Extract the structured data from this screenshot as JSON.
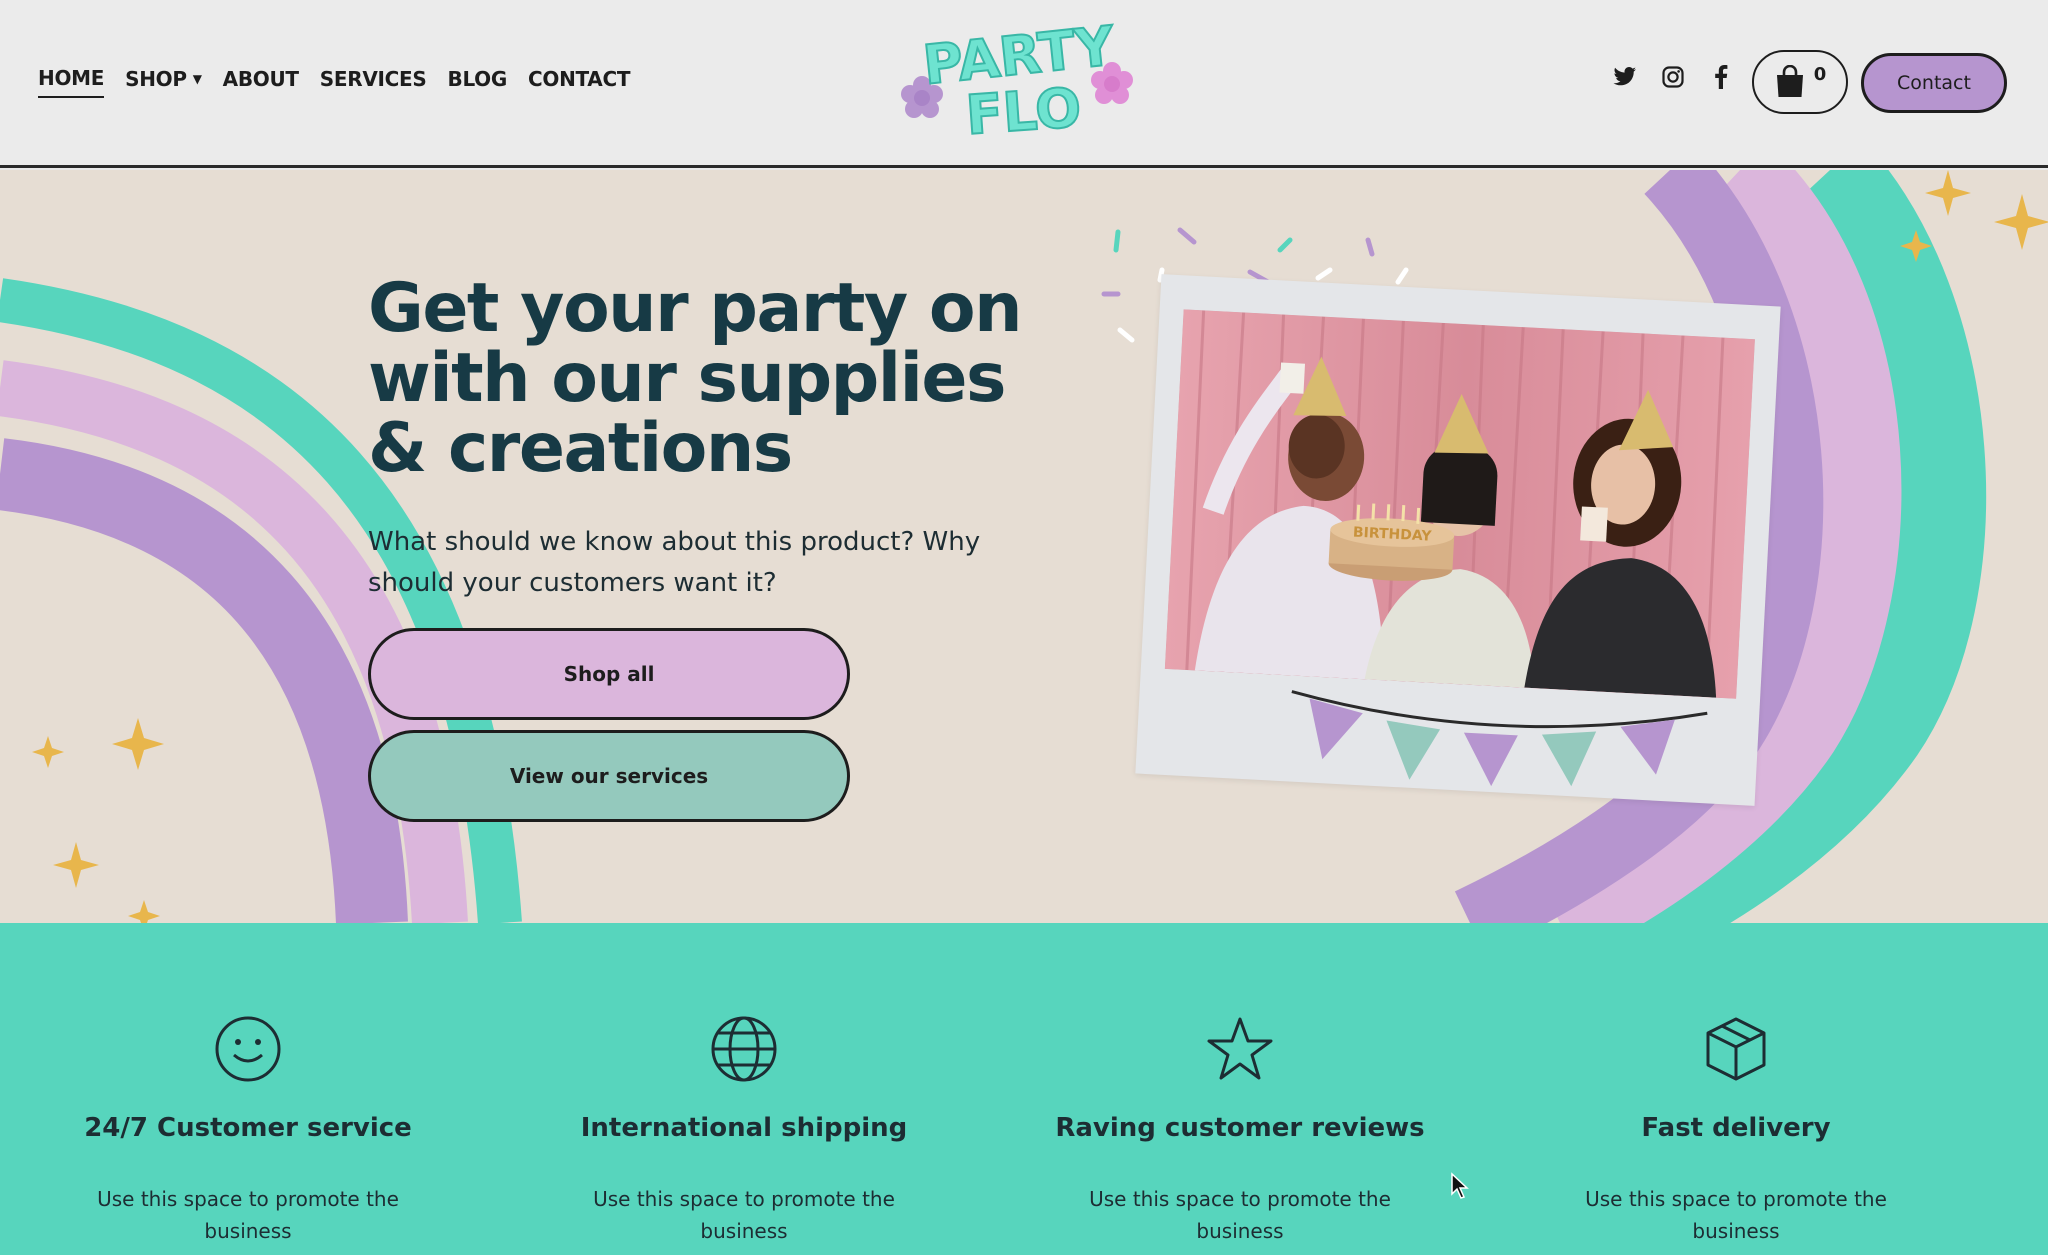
{
  "nav": {
    "items": [
      {
        "label": "HOME"
      },
      {
        "label": "SHOP"
      },
      {
        "label": "ABOUT"
      },
      {
        "label": "SERVICES"
      },
      {
        "label": "BLOG"
      },
      {
        "label": "CONTACT"
      }
    ]
  },
  "logo": {
    "line1": "PARTY",
    "line2": "FLO"
  },
  "header": {
    "cart_count": "0",
    "contact_label": "Contact"
  },
  "socials": [
    "twitter-icon",
    "instagram-icon",
    "facebook-icon"
  ],
  "hero": {
    "title": "Get your party on with our supplies & creations",
    "subtitle": "What should we know about this product? Why should your customers want it?",
    "shop_all_label": "Shop all",
    "services_label": "View our services",
    "cake_text": "BIRTHDAY"
  },
  "features": [
    {
      "icon": "smiley-icon",
      "title": "24/7 Customer service",
      "desc": "Use this space to promote the business"
    },
    {
      "icon": "globe-icon",
      "title": "International shipping",
      "desc": "Use this space to promote the business"
    },
    {
      "icon": "star-icon",
      "title": "Raving customer reviews",
      "desc": "Use this space to promote the business"
    },
    {
      "icon": "box-icon",
      "title": "Fast delivery",
      "desc": "Use this space to promote the business"
    }
  ],
  "colors": {
    "teal": "#57d5bd",
    "lilac": "#b695cf",
    "pink": "#dbb6dc",
    "sage": "#94c9bd",
    "gold": "#e8b64c",
    "navy": "#173a45"
  }
}
